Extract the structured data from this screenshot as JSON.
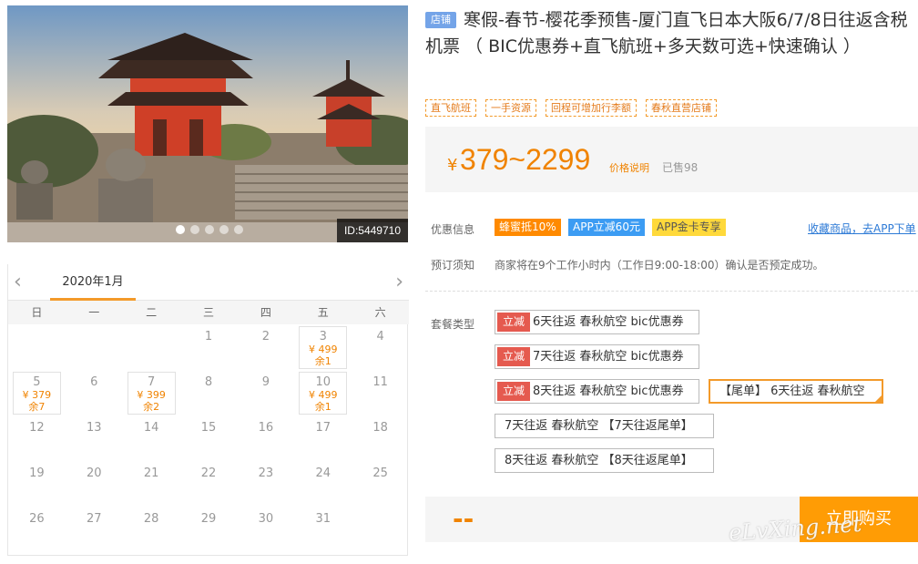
{
  "hero": {
    "id_text": "ID:5449710",
    "slides": 5,
    "active_slide": 0
  },
  "calendar": {
    "month": "2020年1月",
    "prev": "‹",
    "next": "›",
    "weekdays": [
      "日",
      "一",
      "二",
      "三",
      "四",
      "五",
      "六"
    ],
    "weeks": [
      [
        {
          "d": ""
        },
        {
          "d": ""
        },
        {
          "d": ""
        },
        {
          "d": "1"
        },
        {
          "d": "2"
        },
        {
          "d": "3",
          "price": "¥ 499",
          "remain": "余1"
        },
        {
          "d": "4"
        }
      ],
      [
        {
          "d": "5",
          "price": "¥ 379",
          "remain": "余7"
        },
        {
          "d": "6"
        },
        {
          "d": "7",
          "price": "¥ 399",
          "remain": "余2"
        },
        {
          "d": "8"
        },
        {
          "d": "9"
        },
        {
          "d": "10",
          "price": "¥ 499",
          "remain": "余1"
        },
        {
          "d": "11"
        }
      ],
      [
        {
          "d": "12"
        },
        {
          "d": "13"
        },
        {
          "d": "14"
        },
        {
          "d": "15"
        },
        {
          "d": "16"
        },
        {
          "d": "17"
        },
        {
          "d": "18"
        }
      ],
      [
        {
          "d": "19"
        },
        {
          "d": "20"
        },
        {
          "d": "21"
        },
        {
          "d": "22"
        },
        {
          "d": "23"
        },
        {
          "d": "24"
        },
        {
          "d": "25"
        }
      ],
      [
        {
          "d": "26"
        },
        {
          "d": "27"
        },
        {
          "d": "28"
        },
        {
          "d": "29"
        },
        {
          "d": "30"
        },
        {
          "d": "31"
        },
        {
          "d": ""
        }
      ]
    ]
  },
  "product": {
    "tag": "店铺",
    "title": "寒假-春节-樱花季预售-厦门直飞日本大阪6/7/8日往返含税机票 （ BIC优惠券+直飞航班+多天数可选+快速确认 ）",
    "labels": [
      "直飞航班",
      "一手资源",
      "回程可增加行李额",
      "春秋直营店铺"
    ]
  },
  "price": {
    "yen": "¥",
    "range": "379~2299",
    "explain": "价格说明",
    "sold": "已售98"
  },
  "promo": {
    "label": "优惠信息",
    "tags": [
      "蜂蜜抵10%",
      "APP立减60元",
      "APP金卡专享"
    ],
    "favorite": "收藏商品，去APP下单"
  },
  "booking": {
    "label": "预订须知",
    "text": "商家将在9个工作小时内（工作日9:00-18:00）确认是否预定成功。"
  },
  "packages": {
    "label": "套餐类型",
    "cut_tag": "立减",
    "items": [
      "6天往返 春秋航空 bic优惠券",
      "7天往返 春秋航空 bic优惠券",
      "8天往返 春秋航空 bic优惠券",
      "【尾单】 6天往返 春秋航空",
      "7天往返 春秋航空 【7天往返尾单】",
      "8天往返 春秋航空 【8天往返尾单】"
    ]
  },
  "buy": {
    "total": "--",
    "button": "立即购买"
  },
  "watermark": "eLvXing.net",
  "colors": {
    "accent": "#f08300",
    "buy": "#ff9c05",
    "blue_tag": "#3c9cf3",
    "cut_red": "#e55a4f"
  }
}
